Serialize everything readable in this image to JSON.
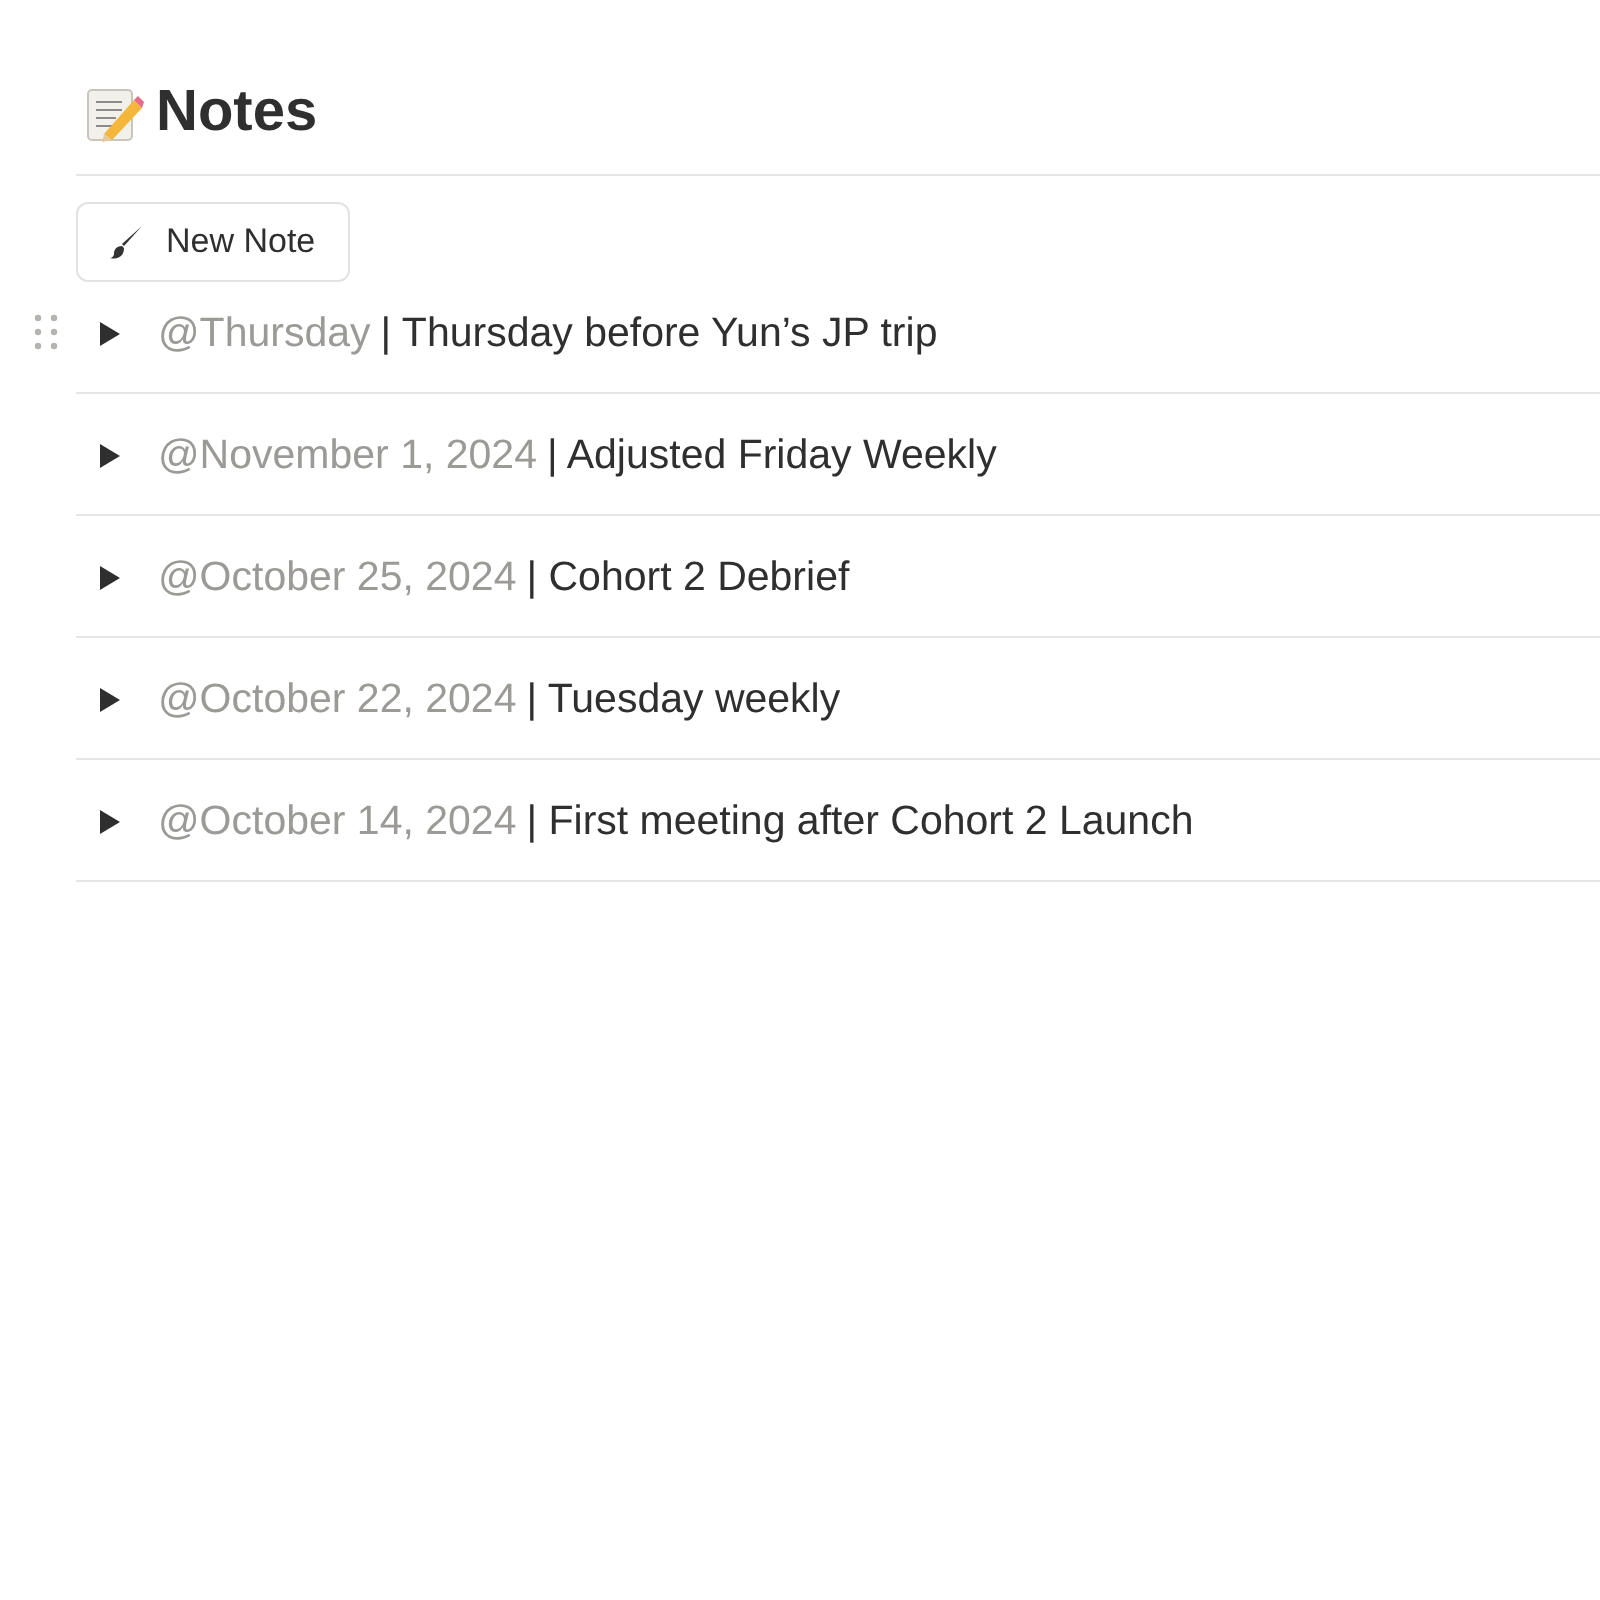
{
  "page": {
    "title": "Notes"
  },
  "new_button": {
    "label": "New Note"
  },
  "notes": [
    {
      "date": "@Thursday",
      "title": "| Thursday before Yun’s JP trip",
      "expanded": false,
      "hovered": true
    },
    {
      "date": "@November 1, 2024",
      "title": "| Adjusted Friday Weekly",
      "expanded": false,
      "hovered": false
    },
    {
      "date": "@October 25, 2024",
      "title": "| Cohort 2 Debrief",
      "expanded": false,
      "hovered": false
    },
    {
      "date": "@October 22, 2024",
      "title": "| Tuesday weekly",
      "expanded": false,
      "hovered": false
    },
    {
      "date": "@October 14, 2024",
      "title": "| First meeting after Cohort 2 Launch",
      "expanded": false,
      "hovered": false
    }
  ]
}
